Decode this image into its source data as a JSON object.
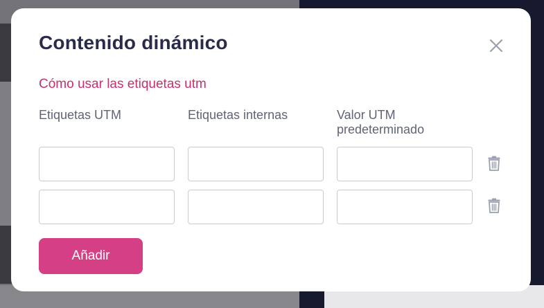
{
  "modal": {
    "title": "Contenido dinámico",
    "help_link": "Cómo usar las etiquetas utm",
    "columns": [
      "Etiquetas UTM",
      "Etiquetas internas",
      "Valor UTM predeterminado"
    ],
    "rows": [
      {
        "utm_tag": "",
        "internal_tag": "",
        "default_value": ""
      },
      {
        "utm_tag": "",
        "internal_tag": "",
        "default_value": ""
      }
    ],
    "add_label": "Añadir"
  },
  "icons": {
    "close": "close-icon",
    "delete": "trash-icon"
  },
  "colors": {
    "title": "#2a2b4a",
    "link": "#c7306e",
    "accent": "#d53f86",
    "icon": "#9aa0ad"
  }
}
